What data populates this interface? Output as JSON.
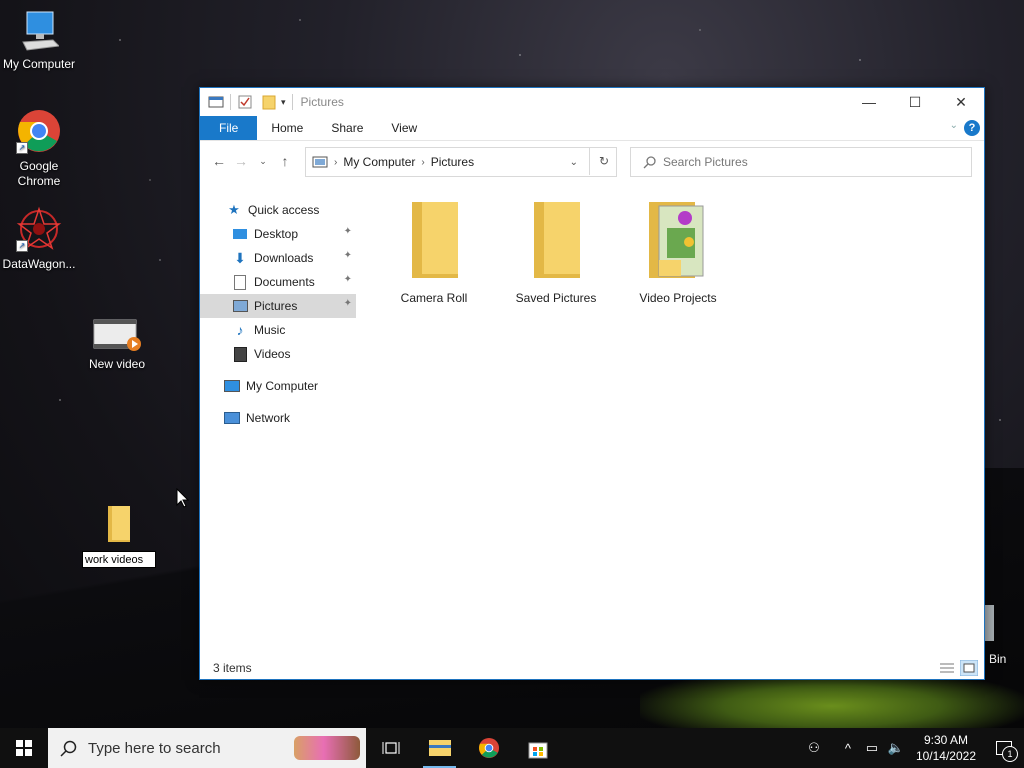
{
  "desktop": {
    "icons": [
      {
        "label": "My Computer"
      },
      {
        "label": "Google Chrome"
      },
      {
        "label": "DataWagon..."
      },
      {
        "label": "New video"
      }
    ],
    "renaming_folder_value": "work videos",
    "recycle_bin_partial_label": "Bin"
  },
  "window": {
    "title": "Pictures",
    "ribbon_tabs": [
      "File",
      "Home",
      "Share",
      "View"
    ],
    "help_glyph": "?",
    "address": {
      "crumbs": [
        "My Computer",
        "Pictures"
      ]
    },
    "search_placeholder": "Search Pictures",
    "nav_pane": {
      "quick_access": "Quick access",
      "quick_items": [
        "Desktop",
        "Downloads",
        "Documents",
        "Pictures",
        "Music",
        "Videos"
      ],
      "selected": "Pictures",
      "my_computer": "My Computer",
      "network": "Network"
    },
    "folders": [
      "Camera Roll",
      "Saved Pictures",
      "Video Projects"
    ],
    "status": "3 items"
  },
  "taskbar": {
    "search_placeholder": "Type here to search",
    "time": "9:30 AM",
    "date": "10/14/2022",
    "notification_count": "1"
  },
  "colors": {
    "accent": "#1979ca",
    "folder": "#f6d36b",
    "folder_dark": "#e3b846"
  }
}
